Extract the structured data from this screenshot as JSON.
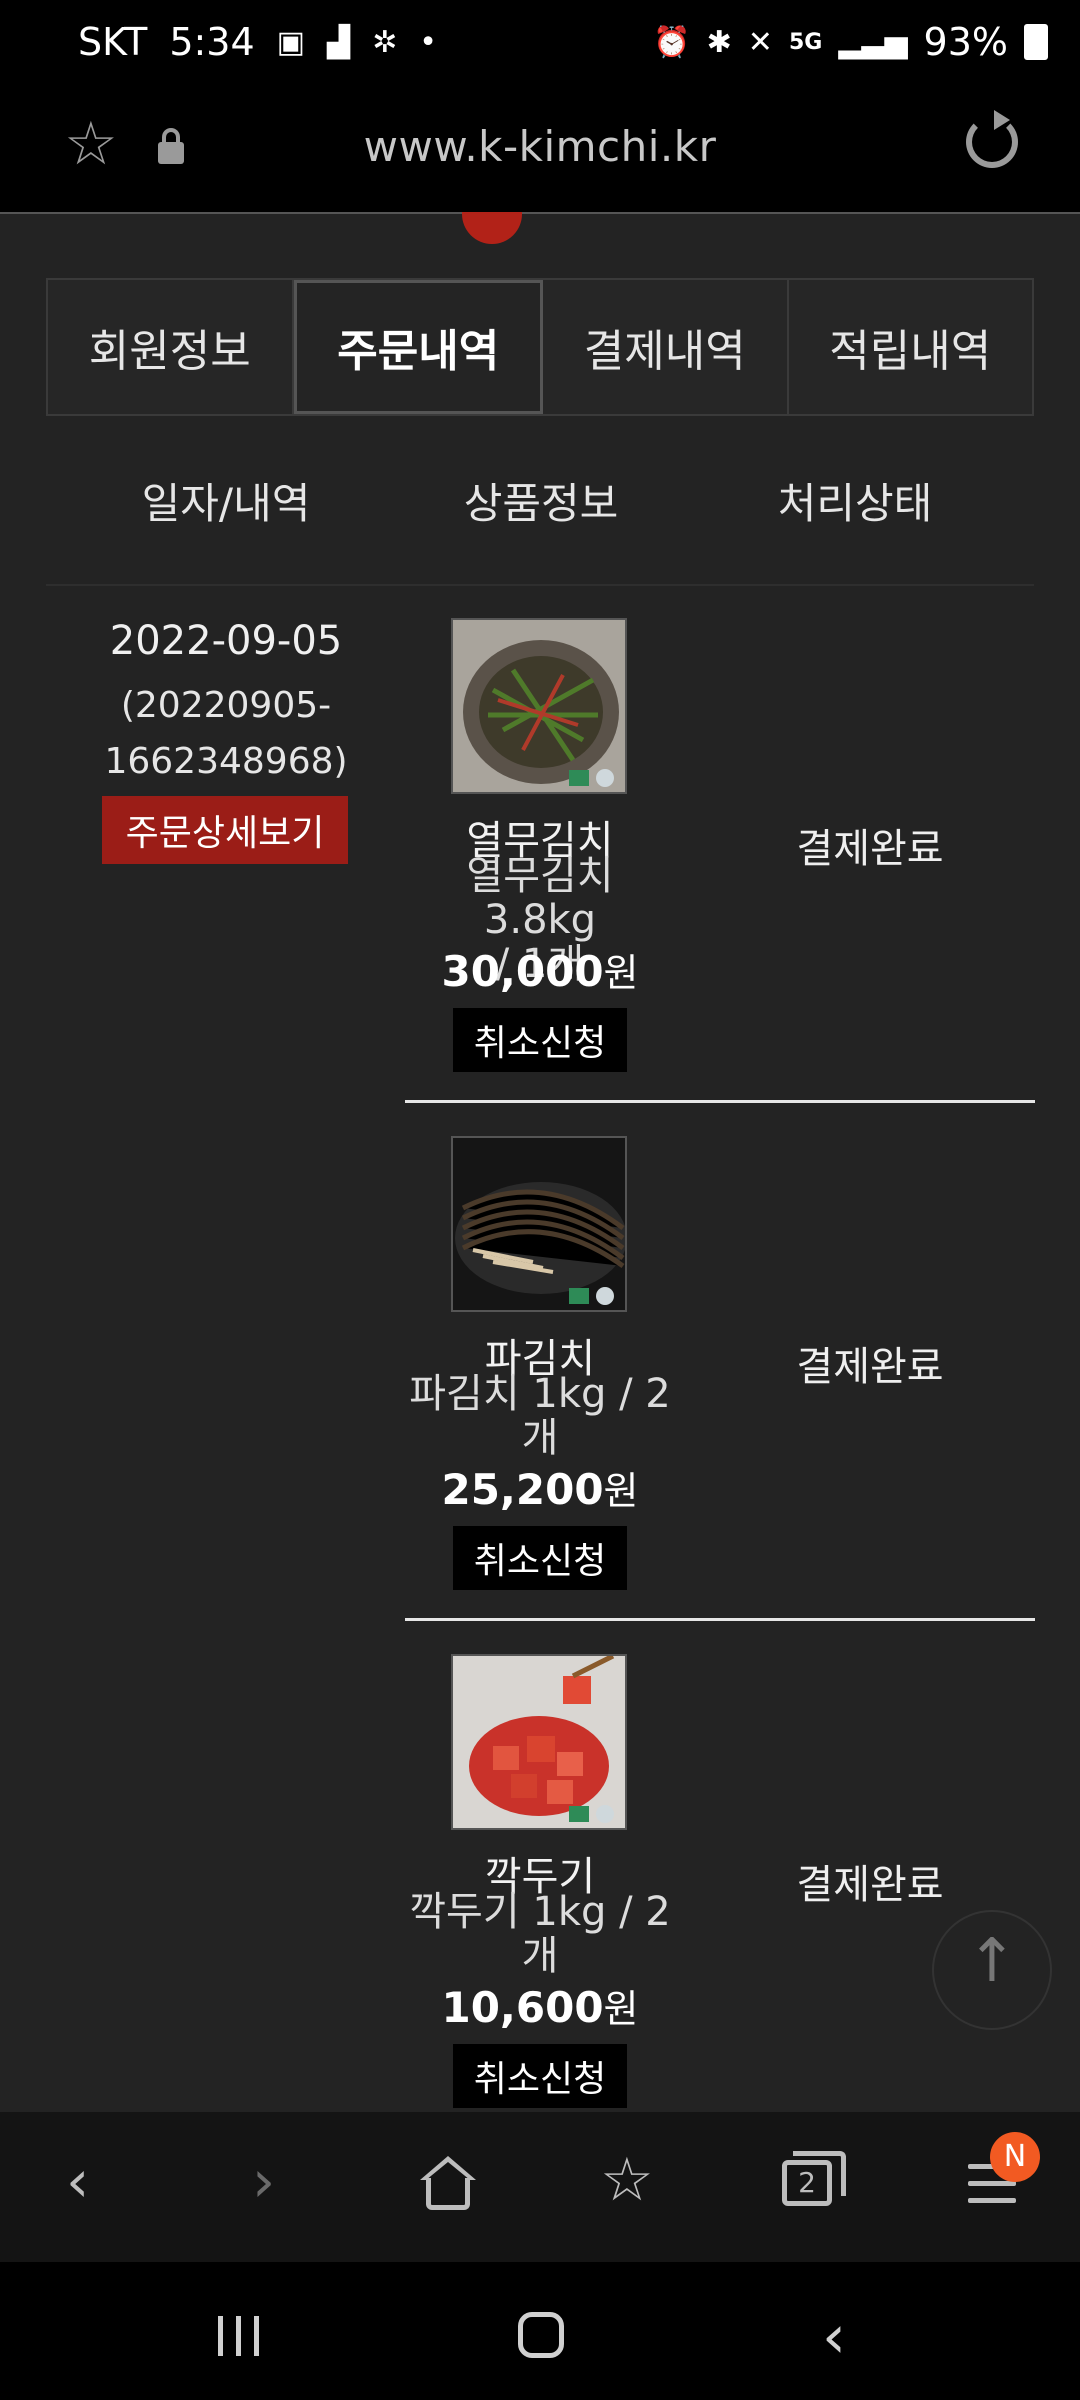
{
  "status_bar": {
    "carrier": "SKT",
    "time": "5:34",
    "network": "5G",
    "battery": "93%"
  },
  "url_bar": {
    "url": "www.k-kimchi.kr"
  },
  "tabs": [
    {
      "label": "회원정보",
      "active": false
    },
    {
      "label": "주문내역",
      "active": true
    },
    {
      "label": "결제내역",
      "active": false
    },
    {
      "label": "적립내역",
      "active": false
    }
  ],
  "table_headers": {
    "date": "일자/내역",
    "product": "상품정보",
    "status": "처리상태"
  },
  "order": {
    "date": "2022-09-05",
    "number_line1": "(20220905-",
    "number_line2": "1662348968)",
    "detail_button": "주문상세보기",
    "items": [
      {
        "name": "열무김치",
        "option_line1": "열무김치 3.8kg",
        "option_line2": "/ 1개",
        "price": "30,000",
        "currency": "원",
        "cancel_button": "취소신청",
        "status": "결제완료"
      },
      {
        "name": "파김치",
        "option_line1": "파김치 1kg / 2",
        "option_line2": "개",
        "price": "25,200",
        "currency": "원",
        "cancel_button": "취소신청",
        "status": "결제완료"
      },
      {
        "name": "깍두기",
        "option_line1": "깍두기 1kg / 2",
        "option_line2": "개",
        "price": "10,600",
        "currency": "원",
        "cancel_button": "취소신청",
        "status": "결제완료"
      }
    ]
  },
  "browser_bar": {
    "tab_count": "2",
    "menu_badge": "N"
  }
}
